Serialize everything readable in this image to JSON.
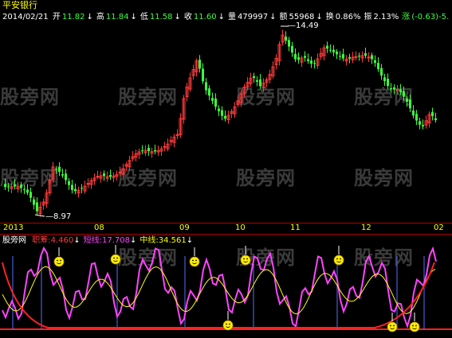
{
  "header": {
    "stock_name": "平安银行",
    "date": "2014/02/21",
    "fields": [
      {
        "label": "开",
        "value": "11.82",
        "arrow": "↓",
        "color": "#3cff3c"
      },
      {
        "label": "高",
        "value": "11.84",
        "arrow": "↓",
        "color": "#3cff3c"
      },
      {
        "label": "低",
        "value": "11.58",
        "arrow": "↓",
        "color": "#3cff3c"
      },
      {
        "label": "收",
        "value": "11.60",
        "arrow": "↓",
        "color": "#3cff3c"
      },
      {
        "label": "量",
        "value": "479997",
        "arrow": "↓",
        "color": "#ffffff"
      },
      {
        "label": "额",
        "value": "55968",
        "arrow": "↓",
        "color": "#ffffff"
      },
      {
        "label": "换",
        "value": "0.86%",
        "arrow": "",
        "color": "#ffffff"
      },
      {
        "label": "振",
        "value": "2.13%",
        "arrow": "",
        "color": "#ffffff"
      },
      {
        "label": "涨",
        "value": "(-0.63)-5.",
        "arrow": "",
        "color": "#3cff3c"
      }
    ]
  },
  "price_chart": {
    "peak_label": "14.49",
    "low_label": "8.97",
    "x_labels": [
      "2013",
      "08",
      "09",
      "10",
      "11",
      "12",
      "02"
    ]
  },
  "indicator": {
    "name": "股旁网",
    "lines": [
      {
        "label": "职筹:",
        "value": "4.460",
        "arrow": "↓",
        "color": "#ff3b3b"
      },
      {
        "label": "短线:",
        "value": "17.708",
        "arrow": "↓",
        "color": "#ff44ff"
      },
      {
        "label": "中线:",
        "value": "34.561",
        "arrow": "↓",
        "color": "#ffff00"
      }
    ]
  },
  "watermark": "股旁网",
  "colors": {
    "up": "#ff3b3b",
    "down": "#3cff3c",
    "axis": "#b00000",
    "short_line": "#ff44ff",
    "mid_line": "#ffff00"
  }
}
